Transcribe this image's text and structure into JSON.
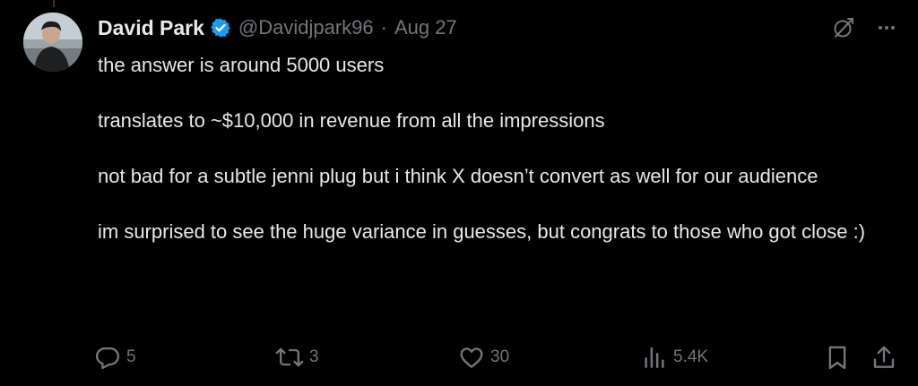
{
  "post": {
    "author": {
      "display_name": "David Park",
      "handle": "@Davidjpark96",
      "verified": true
    },
    "separator": "·",
    "timestamp": "Aug 27",
    "paragraphs": [
      "the answer is around 5000 users",
      "translates to ~$10,000 in revenue from all the impressions",
      "not bad for a subtle jenni plug but i think X doesn’t convert as well for our audience",
      "im surprised to see the huge variance in guesses, but congrats to those who got close :)"
    ],
    "stats": {
      "replies": "5",
      "reposts": "3",
      "likes": "30",
      "views": "5.4K"
    }
  },
  "icons": {
    "verified": "verified-badge-icon",
    "grok": "grok-icon",
    "more": "more-options-icon",
    "reply": "reply-icon",
    "repost": "repost-icon",
    "like": "heart-icon",
    "views": "views-chart-icon",
    "bookmark": "bookmark-icon",
    "share": "share-icon"
  },
  "colors": {
    "background": "#000000",
    "text_primary": "#e7e9ea",
    "text_secondary": "#71767b",
    "verified_blue": "#1d9bf0"
  }
}
